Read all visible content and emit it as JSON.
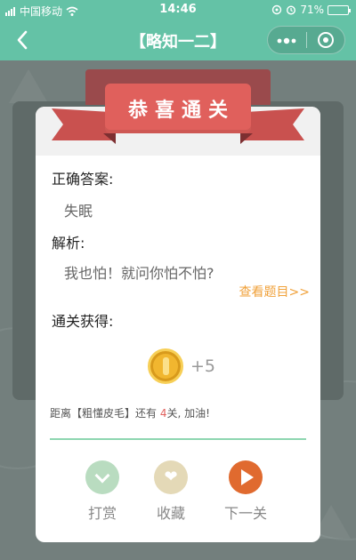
{
  "status_bar": {
    "carrier": "中国移动",
    "time": "14:46",
    "battery": "71%",
    "battery_level": 0.71
  },
  "nav": {
    "back_icon": "chevron-left-icon",
    "title": "【略知一二】",
    "more_icon": "more-dots-icon",
    "close_icon": "close-circle-icon"
  },
  "modal": {
    "ribbon_title": "恭喜通关",
    "answer_label": "正确答案:",
    "answer_value": "失眠",
    "analysis_label": "解析:",
    "analysis_value": "我也怕！就问你怕不怕?",
    "view_question_link": "查看题目>>",
    "reward_label": "通关获得:",
    "reward_icon": "coin-icon",
    "reward_amount": "+5",
    "progress_prefix": "距离【粗懂皮毛】还有 ",
    "progress_number": "4",
    "progress_suffix": "关, 加油!",
    "actions": [
      {
        "label": "打赏",
        "icon": "chevron-down-icon",
        "color": "#b9dcc0"
      },
      {
        "label": "收藏",
        "icon": "heart-icon",
        "color": "#e4d9b7"
      },
      {
        "label": "下一关",
        "icon": "play-icon",
        "color": "#e06a2f"
      }
    ]
  },
  "colors": {
    "accent": "#64c2a6",
    "ribbon": "#e0605c",
    "link": "#f0a13a"
  }
}
